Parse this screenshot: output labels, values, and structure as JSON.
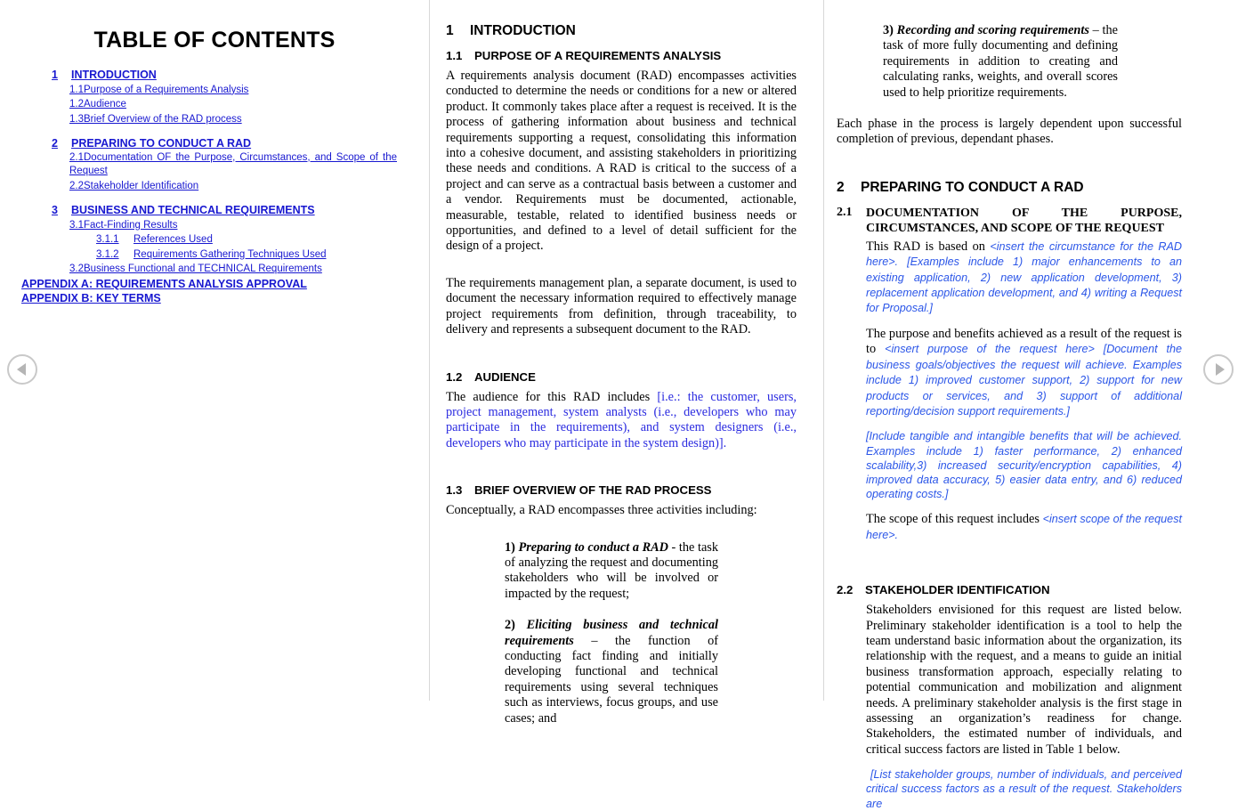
{
  "viewer": {
    "prev_label": "◀",
    "next_label": "▶"
  },
  "toc": {
    "title": "TABLE OF CONTENTS",
    "entries": [
      {
        "level": 1,
        "num": "1",
        "label": "INTRODUCTION"
      },
      {
        "level": 2,
        "num": "1.1",
        "label": "Purpose of a Requirements Analysis"
      },
      {
        "level": 2,
        "num": "1.2",
        "label": "Audience"
      },
      {
        "level": 2,
        "num": "1.3",
        "label": "Brief Overview of the RAD process"
      },
      {
        "level": 1,
        "num": "2",
        "label": "PREPARING TO CONDUCT A RAD"
      },
      {
        "level": 2,
        "num": "2.1",
        "label": "Documentation OF the Purpose, Circumstances, and Scope of the Request",
        "wrap": true
      },
      {
        "level": 2,
        "num": "2.2",
        "label": "Stakeholder Identification"
      },
      {
        "level": 1,
        "num": "3",
        "label": "BUSINESS AND TECHNICAL REQUIREMENTS"
      },
      {
        "level": 2,
        "num": "3.1",
        "label": "Fact-Finding Results"
      },
      {
        "level": 3,
        "num": "3.1.1",
        "label": "References Used"
      },
      {
        "level": 3,
        "num": "3.1.2",
        "label": "Requirements Gathering Techniques Used"
      },
      {
        "level": 2,
        "num": "3.2",
        "label": "Business Functional and TECHNICAL Requirements"
      },
      {
        "level": 0,
        "num": "",
        "label": "APPENDIX A: REQUIREMENTS ANALYSIS APPROVAL"
      },
      {
        "level": 0,
        "num": "",
        "label": "APPENDIX B: KEY TERMS"
      }
    ]
  },
  "mid": {
    "h1_num": "1",
    "h1_label": "INTRODUCTION",
    "s11_num": "1.1",
    "s11_label": "PURPOSE OF A REQUIREMENTS ANALYSIS",
    "s11_p1": "A requirements analysis document (RAD) encompasses activities conducted to determine the needs or conditions for a new or altered product.  It commonly takes place after a request is received.  It is the process of gathering information about business and technical requirements supporting a request, consolidating this information into a cohesive document, and assisting stakeholders in prioritizing these needs and conditions.  A RAD is critical to the success of a project and can serve as a contractual basis between a customer and a vendor.  Requirements must be documented, actionable, measurable, testable, related to identified business needs or opportunities, and defined to a level of detail sufficient for the design of a project.",
    "s11_p2": "The requirements management plan, a separate document, is used to document the necessary information required to effectively manage project requirements from definition, through traceability, to delivery and represents a subsequent document to the RAD.",
    "s12_num": "1.2",
    "s12_label": "AUDIENCE",
    "s12_p1_black": "The audience for this RAD includes ",
    "s12_p1_blue": "[i.e.: the customer, users, project management, system analysts (i.e., developers who may participate in the requirements), and system designers (i.e., developers who may participate in the system design)].",
    "s13_num": "1.3",
    "s13_label": "BRIEF OVERVIEW OF THE RAD PROCESS",
    "s13_p1": "Conceptually, a RAD encompasses three activities including:",
    "activity1_marker": "1) ",
    "activity1_lead": "Preparing to conduct a RAD",
    "activity1_rest": " - the task of analyzing the request and documenting stakeholders who will be involved or impacted by the request;",
    "activity2_marker": "2) ",
    "activity2_lead": "Eliciting business and technical requirements",
    "activity2_rest": " – the function of conducting fact finding and initially developing functional and technical requirements using several techniques such as interviews, focus groups, and use cases; and"
  },
  "right": {
    "activity3_marker": "3) ",
    "activity3_lead": "Recording and scoring requirements",
    "activity3_rest": " – the task of more fully documenting and defining requirements in addition to creating and calculating ranks, weights, and overall scores used to help prioritize requirements.",
    "phase_p": "Each phase in the process is largely dependent upon successful completion of previous, dependant phases.",
    "h1_num": "2",
    "h1_label": "PREPARING TO CONDUCT A RAD",
    "s21_num": "2.1",
    "s21_line1": "DOCUMENTATION OF THE PURPOSE,",
    "s21_line2": "CIRCUMSTANCES, AND SCOPE OF THE REQUEST",
    "s21_p1_black": "This RAD is based on ",
    "s21_p1_blue": "<insert the circumstance for the RAD here>. [Examples include 1) major enhancements to an existing application, 2) new application development, 3) replacement application development, and 4) writing a Request for Proposal.]",
    "s21_p2_black": "The purpose and benefits achieved as a result of the request is to ",
    "s21_p2_blue": "<insert purpose of the request here> [Document the business goals/objectives the request will achieve.  Examples include 1) improved customer support, 2) support for new products or services, and 3) support of additional reporting/decision support requirements.]",
    "s21_p3_blue": "[Include tangible and intangible benefits that will be achieved. Examples include 1) faster performance, 2) enhanced scalability,3) increased security/encryption capabilities, 4) improved data accuracy, 5) easier data entry, and 6) reduced operating costs.]",
    "s21_p4_black": "The scope of this request includes ",
    "s21_p4_blue": "<insert scope of the request here>.",
    "s22_num": "2.2",
    "s22_label": "STAKEHOLDER IDENTIFICATION",
    "s22_p1": "Stakeholders envisioned for this request are listed below.  Preliminary stakeholder identification is a tool to help the team understand basic information about the organization, its relationship with the request, and a means to guide an initial business transformation approach, especially relating to potential communication and mobilization and alignment needs.  A preliminary stakeholder analysis is the first stage in assessing an organization’s readiness for change.  Stakeholders, the estimated number of individuals, and critical success factors are listed in Table 1 below.",
    "s22_p2_blue": "[List stakeholder groups, number of individuals, and perceived critical success factors as a result of the request.  Stakeholders are"
  },
  "colors": {
    "link": "#1818d0",
    "instruction": "#2b56e8",
    "divider": "#d8d8d8",
    "arrow": "#b5b5b5"
  }
}
